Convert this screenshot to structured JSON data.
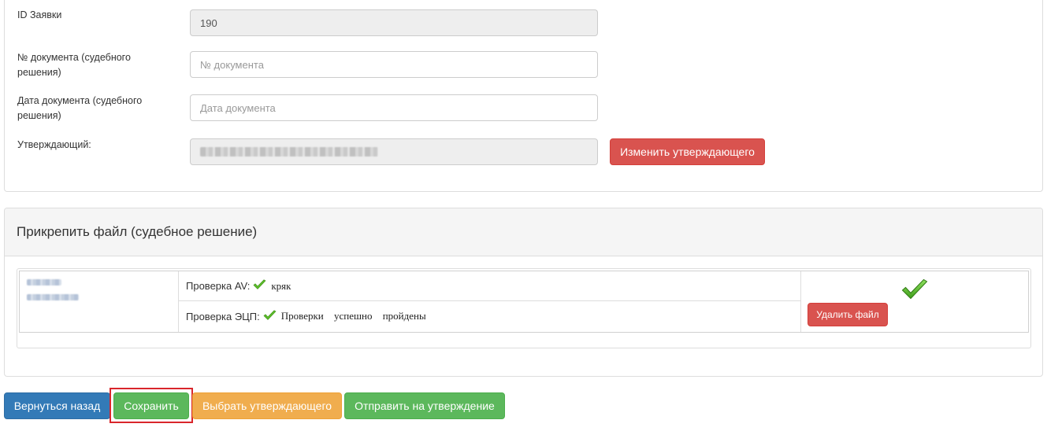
{
  "form": {
    "request_id": {
      "label": "ID Заявки",
      "value": "190"
    },
    "doc_number": {
      "label": "№ документа (судебного решения)",
      "placeholder": "№ документа"
    },
    "doc_date": {
      "label": "Дата документа (судебного решения)",
      "placeholder": "Дата документа"
    },
    "approver": {
      "label": "Утверждающий:",
      "change_button": "Изменить утверждающего"
    }
  },
  "attach": {
    "title": "Прикрепить файл (судебное решение)",
    "av_check": {
      "label": "Проверка AV:",
      "result": "кряк"
    },
    "sig_check": {
      "label": "Проверка ЭЦП:",
      "result": "Проверки успешно пройдены"
    },
    "delete_button": "Удалить файл"
  },
  "actions": {
    "back": "Вернуться назад",
    "save": "Сохранить",
    "choose_approver": "Выбрать утверждающего",
    "send_for_approval": "Отправить на утверждение"
  },
  "colors": {
    "primary": "#337ab7",
    "success": "#5cb85c",
    "warning": "#f0ad4e",
    "danger": "#d9534f",
    "highlight": "#d9262b"
  },
  "icons": {
    "check": "check-icon",
    "big_check": "big-check-icon"
  }
}
